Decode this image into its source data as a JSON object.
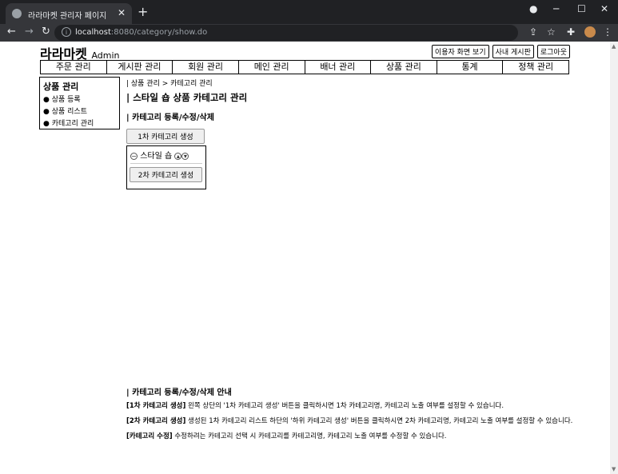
{
  "browser": {
    "tab_title": "라라마켓 관리자 페이지",
    "url_host": "localhost",
    "url_path": ":8080/category/show.do"
  },
  "header": {
    "logo": "라라마켓",
    "logo_sub": "Admin",
    "buttons": [
      "이용자 화면 보기",
      "사내 게시판",
      "로그아웃"
    ]
  },
  "gnb": [
    "주문 관리",
    "게시판 관리",
    "회원 관리",
    "메인 관리",
    "배너 관리",
    "상품 관리",
    "통계",
    "정책 관리"
  ],
  "lnb": {
    "title": "상품 관리",
    "items": [
      "상품 등록",
      "상품 리스트",
      "카테고리 관리"
    ]
  },
  "content": {
    "breadcrumb": "| 상품 관리 > 카테고리 관리",
    "title": "| 스타일 숍 상품 카테고리 관리",
    "subtitle": "| 카테고리 등록/수정/삭제",
    "btn_create_first": "1차 카테고리 생성",
    "category_name": "스타일 숍",
    "btn_create_second": "2차 카테고리 생성"
  },
  "guide": {
    "title": "| 카테고리 등록/수정/삭제 안내",
    "items": [
      {
        "label": "[1차 카테고리 생성]",
        "text": " 왼쪽 상단의 '1차 카테고리 생성' 버튼을 클릭하시면 1차 카테고리명, 카테고리 노출 여부를 설정할 수 있습니다."
      },
      {
        "label": "[2차 카테고리 생성]",
        "text": " 생성된 1차 카테고리 리스트 하단의 '하위 카테고리 생성' 버튼을 클릭하시면 2차 카테고리명, 카테고리 노출 여부를 설정할 수 있습니다."
      },
      {
        "label": "[카테고리 수정]",
        "text": " 수정하려는 카테고리 선택 시 카테고리를 카테고리명, 카테고리 노출 여부를 수정할 수 있습니다."
      }
    ]
  }
}
